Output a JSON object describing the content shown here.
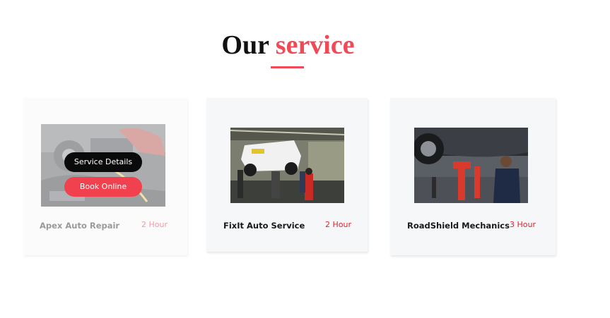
{
  "section": {
    "title_main": "Our",
    "title_accent": "service"
  },
  "colors": {
    "accent": "#ef4a56",
    "price_red": "#e0232d",
    "card_bg": "#f6f7f9",
    "details_button": "#0a0a0a",
    "book_button": "#f1414f"
  },
  "services": [
    {
      "name": "Apex Auto Repair",
      "duration": "2 Hour",
      "image": "engine-repair-photo",
      "hovered": true,
      "details_label": "Service Details",
      "book_label": "Book Online"
    },
    {
      "name": "FixIt Auto Service",
      "duration": "2 Hour",
      "image": "car-on-lift-photo",
      "hovered": false
    },
    {
      "name": "RoadShield Mechanics",
      "duration": "3 Hour",
      "image": "under-car-inspection-photo",
      "hovered": false
    }
  ]
}
